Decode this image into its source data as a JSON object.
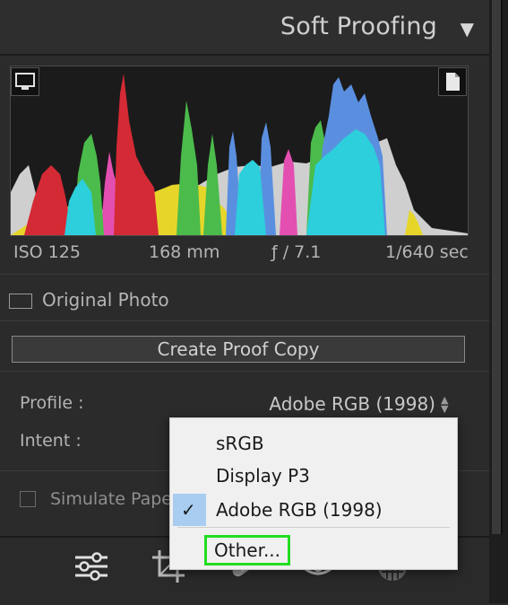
{
  "panel": {
    "title": "Soft Proofing",
    "toggle_glyph": "▼"
  },
  "histogram": {
    "left_clip_icon": "monitor-icon",
    "right_clip_icon": "page-icon"
  },
  "meta": {
    "iso": "ISO 125",
    "focal": "168 mm",
    "aperture": "ƒ / 7.1",
    "shutter": "1/640 sec"
  },
  "original_photo": {
    "label": "Original Photo",
    "checked": false
  },
  "proof_copy_button": "Create Proof Copy",
  "profile": {
    "label": "Profile :",
    "value": "Adobe RGB (1998)",
    "arrows": "▲▼"
  },
  "intent": {
    "label": "Intent :"
  },
  "simulate": {
    "label": "Simulate Pape",
    "checked": false
  },
  "profile_menu": {
    "items": [
      {
        "label": "sRGB",
        "selected": false
      },
      {
        "label": "Display P3",
        "selected": false
      },
      {
        "label": "Adobe RGB (1998)",
        "selected": true
      }
    ],
    "other_label": "Other...",
    "check_glyph": "✓",
    "highlight_color": "#22dd22",
    "selection_color": "#a8cdf0"
  },
  "toolbar": {
    "tools": [
      "sliders-icon",
      "crop-icon",
      "healing-icon",
      "redeye-icon",
      "mask-icon"
    ]
  }
}
